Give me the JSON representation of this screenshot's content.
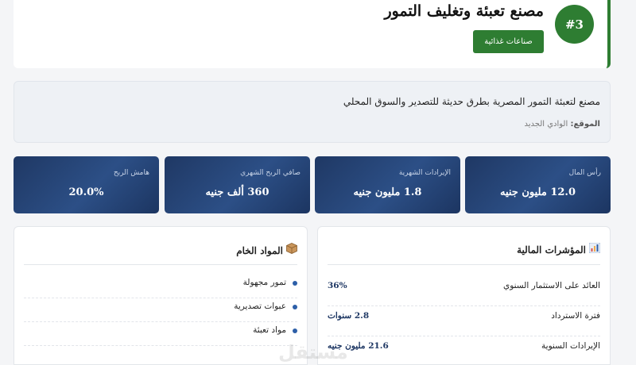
{
  "factory": {
    "rank": "#3",
    "title": "مصنع تعبئة وتغليف التمور",
    "category": "صناعات غذائية",
    "description": "مصنع لتعبئة التمور المصرية بطرق حديثة للتصدير والسوق المحلي",
    "location_label": "الموقع:",
    "location_value": "الوادي الجديد",
    "accent_color": "#2e7d32"
  },
  "stats": [
    {
      "label": "رأس المال",
      "value": "12.0 مليون جنيه"
    },
    {
      "label": "الإيرادات الشهرية",
      "value": "1.8 مليون جنيه"
    },
    {
      "label": "صافي الربح الشهري",
      "value": "360 ألف جنيه"
    },
    {
      "label": "هامش الربح",
      "value": "20.0%"
    }
  ],
  "financial": {
    "icon": "bar-chart-icon",
    "title": "المؤشرات المالية",
    "rows": [
      {
        "label": "العائد على الاستثمار السنوي",
        "value": "36%"
      },
      {
        "label": "فترة الاسترداد",
        "value": "2.8 سنوات"
      },
      {
        "label": "الإيرادات السنوية",
        "value": "21.6 مليون جنيه"
      }
    ]
  },
  "raw_materials": {
    "icon": "package-icon",
    "title": "المواد الخام",
    "items": [
      "تمور مجهولة",
      "عبوات تصديرية",
      "مواد تعبئة"
    ]
  },
  "watermark": "مستقل"
}
